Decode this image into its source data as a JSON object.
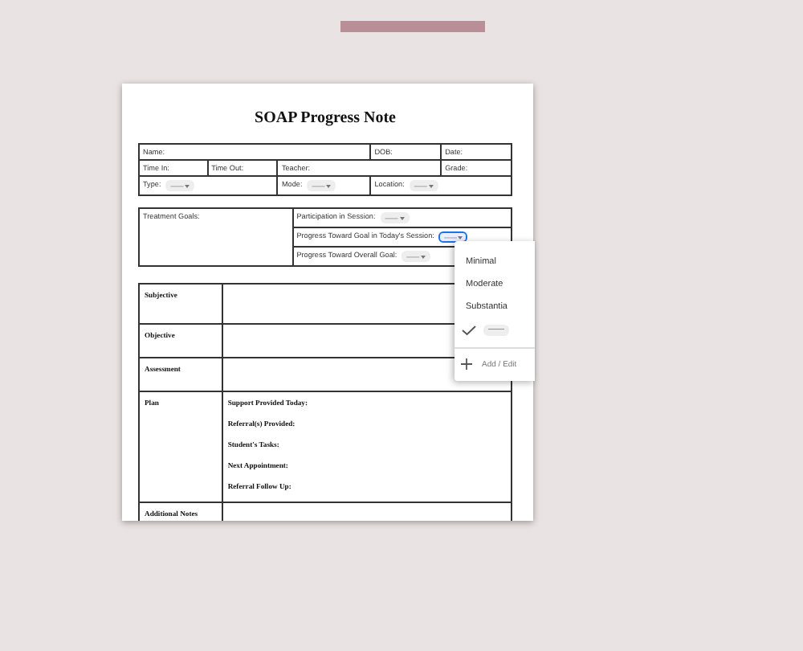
{
  "document": {
    "title": "SOAP Progress Note",
    "info_rows": [
      [
        {
          "label": "Name:"
        },
        {
          "label": "DOB:"
        },
        {
          "label": "Date:"
        }
      ],
      [
        {
          "label": "Time In:"
        },
        {
          "label": "Time Out:"
        },
        {
          "label": "Teacher:"
        },
        {
          "label": "Grade:"
        }
      ],
      [
        {
          "label": "Type:",
          "dropdown": {
            "value": "——",
            "open": false
          }
        },
        {
          "label": "Mode:",
          "dropdown": {
            "value": "——",
            "open": false
          }
        },
        {
          "label": "Location:",
          "dropdown": {
            "value": "——",
            "open": false
          }
        }
      ]
    ],
    "goals": {
      "label": "Treatment Goals:",
      "items": [
        {
          "label": "Participation in Session:",
          "dropdown": {
            "value": "——",
            "open": false
          }
        },
        {
          "label": "Progress Toward Goal in Today's Session:",
          "dropdown": {
            "value": "——",
            "open": true
          }
        },
        {
          "label": "Progress Toward Overall Goal:",
          "dropdown": {
            "value": "——",
            "open": false
          }
        }
      ]
    },
    "soap": [
      {
        "label": "Subjective"
      },
      {
        "label": "Objective"
      },
      {
        "label": "Assessment"
      },
      {
        "label": "Plan",
        "fields": [
          "Support Provided Today:",
          "Referral(s) Provided:",
          "Student's Tasks:",
          "Next Appointment:",
          "Referral Follow Up:"
        ]
      },
      {
        "label": "Additional Notes"
      }
    ]
  },
  "dropdown_menu": {
    "options": [
      {
        "label": "Minimal",
        "selected": false,
        "kind": "text"
      },
      {
        "label": "Moderate",
        "selected": false,
        "kind": "text"
      },
      {
        "label": "Substantia",
        "selected": false,
        "kind": "text"
      },
      {
        "label": "——",
        "selected": true,
        "kind": "chip"
      }
    ],
    "action": "Add / Edit"
  }
}
